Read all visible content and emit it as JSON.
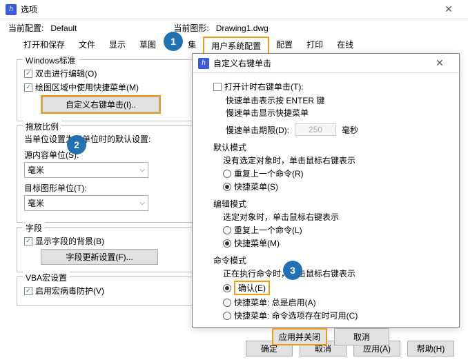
{
  "window": {
    "title": "选项",
    "icon_text": "h"
  },
  "config": {
    "current_cfg_label": "当前配置:",
    "current_cfg": "Default",
    "current_drawing_label": "当前图形:",
    "current_drawing": "Drawing1.dwg"
  },
  "tabs": [
    "打开和保存",
    "文件",
    "显示",
    "草图",
    "集",
    "用户系统配置",
    "配置",
    "打印",
    "在线"
  ],
  "left": {
    "g1_title": "Windows标准",
    "g1_chk1": "双击进行编辑(O)",
    "g1_chk2": "绘图区域中使用快捷菜单(M)",
    "g1_btn": "自定义右键单击(I)..",
    "g2_title": "拖放比例",
    "g2_text": "当单位设置为无单位时的默认设置:",
    "g2_lbl1": "源内容单位(S):",
    "g2_sel1": "毫米",
    "g2_lbl2": "目标图形单位(T):",
    "g2_sel2": "毫米",
    "g3_title": "字段",
    "g3_chk": "显示字段的背景(B)",
    "g3_btn": "字段更新设置(F)...",
    "g4_title": "VBA宏设置",
    "g4_chk": "启用宏病毒防护(V)"
  },
  "dialog": {
    "title": "自定义右键单击",
    "chk1": "打开计时右键单击(T):",
    "line1": "快速单击表示按 ENTER 键",
    "line2": "慢速单击显示快捷菜单",
    "slow_label": "慢速单击期限(D):",
    "slow_value": "250",
    "ms": "毫秒",
    "s1_head": "默认模式",
    "s1_note": "没有选定对象时，单击鼠标右键表示",
    "s1_r1": "重复上一个命令(R)",
    "s1_r2": "快捷菜单(S)",
    "s2_head": "编辑模式",
    "s2_note": "选定对象时，单击鼠标右键表示",
    "s2_r1": "重复上一个命令(L)",
    "s2_r2": "快捷菜单(M)",
    "s3_head": "命令模式",
    "s3_note": "正在执行命令时，单击鼠标右键表示",
    "s3_r1": "确认(E)",
    "s3_r2": "快捷菜单: 总是启用(A)",
    "s3_r3": "快捷菜单: 命令选项存在时可用(C)",
    "apply_close": "应用并关闭",
    "cancel": "取消"
  },
  "bottom": {
    "ok": "确定",
    "cancel": "取消",
    "apply": "应用(A)",
    "help": "帮助(H)"
  },
  "badges": {
    "b1": "1",
    "b2": "2",
    "b3": "3"
  }
}
